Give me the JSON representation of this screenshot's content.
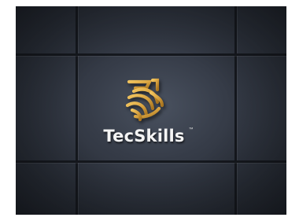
{
  "brand": {
    "name": "TecSkills",
    "trademark": "™"
  },
  "colors": {
    "wall": "#2e333d",
    "seam": "#15181e",
    "logo_gold": "#d9a441",
    "logo_gold_dark": "#a8741f",
    "wordmark": "#f4f4f4"
  },
  "icons": {
    "logo": "tecskills-logo-mark"
  }
}
